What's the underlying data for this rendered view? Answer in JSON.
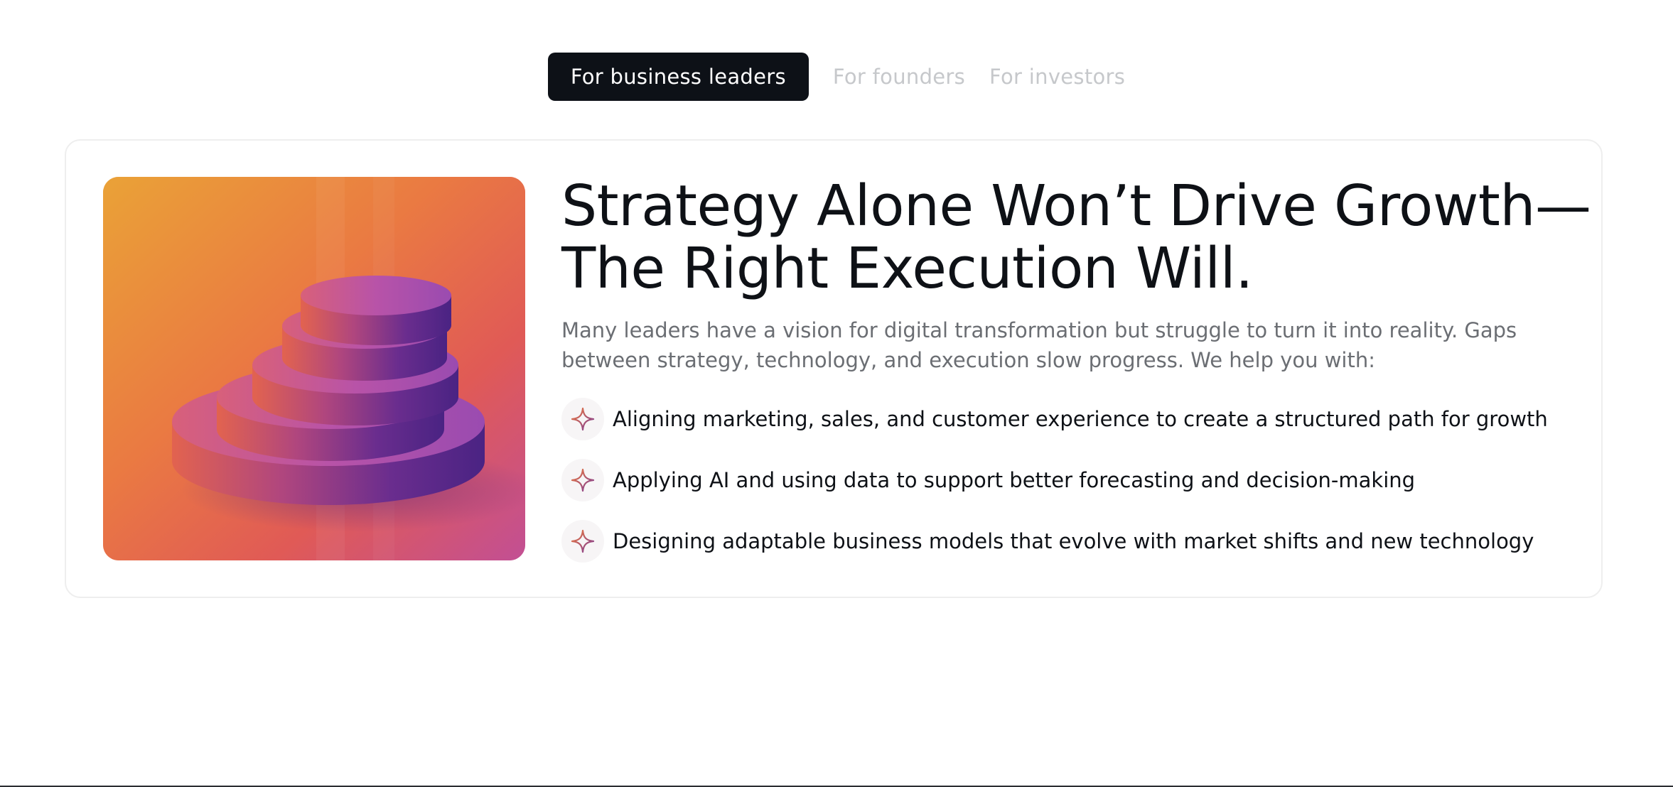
{
  "tabs": [
    {
      "label": "For business leaders",
      "active": true
    },
    {
      "label": "For founders",
      "active": false
    },
    {
      "label": "For investors",
      "active": false
    }
  ],
  "card": {
    "image_icon": "stacked-discs-image",
    "headline_line1": "Strategy Alone Won’t Drive Growth—",
    "headline_line2": "The Right Execution Will.",
    "intro": "Many leaders have a vision for digital transformation but struggle to turn it into reality. Gaps between strategy, technology, and execution slow progress. We help you with:",
    "bullet_icon": "sparkle-icon",
    "bullets": [
      "Aligning marketing, sales, and customer experience to create a structured path for growth",
      "Applying AI and using data to support better forecasting and decision-making",
      "Designing adaptable business models that evolve with market shifts and new technology"
    ]
  },
  "colors": {
    "tab_active_bg": "#0d1117",
    "tab_inactive_text": "#c6c8cb",
    "headline": "#0e1116",
    "intro_text": "#6b6e73",
    "sparkle_gradient_start": "#f07a3a",
    "sparkle_gradient_end": "#7a3a9a"
  }
}
